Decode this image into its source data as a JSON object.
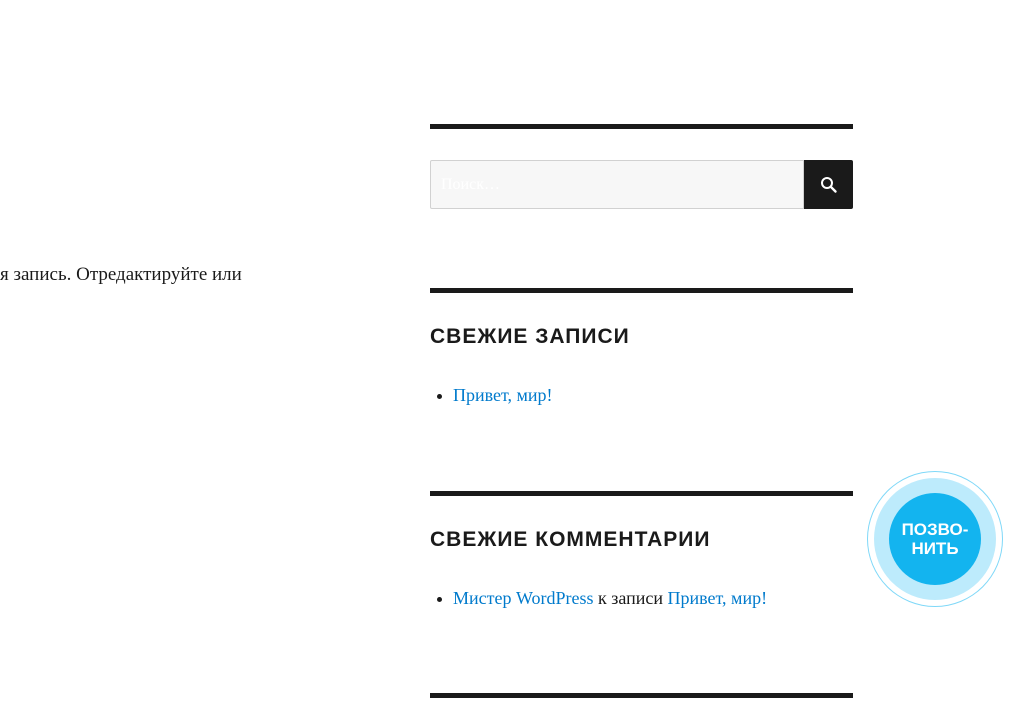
{
  "main": {
    "snippet": "я запись. Отредактируйте или"
  },
  "search": {
    "placeholder": "Поиск…",
    "button_icon": "search-icon"
  },
  "recent_posts": {
    "title": "СВЕЖИЕ ЗАПИСИ",
    "items": [
      {
        "label": "Привет, мир!"
      }
    ]
  },
  "recent_comments": {
    "title": "СВЕЖИЕ КОММЕНТАРИИ",
    "items": [
      {
        "author": "Мистер WordPress",
        "connector": " к записи ",
        "post": "Привет, мир!"
      }
    ]
  },
  "call_widget": {
    "line1": "ПОЗВО-",
    "line2": "НИТЬ"
  },
  "colors": {
    "text": "#1a1a1a",
    "link": "#007acc",
    "call_button": "#13b4ef",
    "call_ring": "#bdebfc"
  }
}
